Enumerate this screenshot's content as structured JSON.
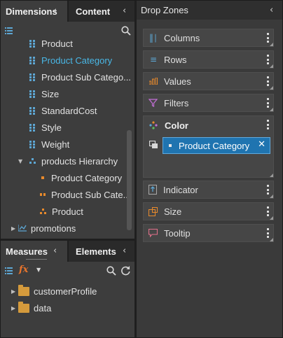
{
  "dimensions_panel": {
    "tab_dimensions": "Dimensions",
    "tab_content": "Content",
    "items": [
      {
        "label": "Product",
        "type": "field"
      },
      {
        "label": "Product Category",
        "type": "field",
        "selected": true
      },
      {
        "label": "Product Sub Catego...",
        "type": "field"
      },
      {
        "label": "Size",
        "type": "field"
      },
      {
        "label": "StandardCost",
        "type": "field"
      },
      {
        "label": "Style",
        "type": "field"
      },
      {
        "label": "Weight",
        "type": "field"
      },
      {
        "label": "products Hierarchy",
        "type": "hierarchy",
        "expanded": true
      },
      {
        "label": "Product Category",
        "type": "level-1"
      },
      {
        "label": "Product Sub Cate...",
        "type": "level-2"
      },
      {
        "label": "Product",
        "type": "level-3"
      },
      {
        "label": "promotions",
        "type": "table",
        "expanded": false
      }
    ]
  },
  "measures_panel": {
    "tab_measures": "Measures",
    "tab_elements": "Elements",
    "items": [
      {
        "label": "customerProfile"
      },
      {
        "label": "data"
      }
    ]
  },
  "drop_zones": {
    "title": "Drop Zones",
    "zones": {
      "columns": "Columns",
      "rows": "Rows",
      "values": "Values",
      "filters": "Filters",
      "color": "Color",
      "indicator": "Indicator",
      "size": "Size",
      "tooltip": "Tooltip"
    },
    "color_chip": "Product Category"
  },
  "icons": {
    "list": "list-icon",
    "search": "search-icon",
    "formula": "fx-icon",
    "refresh": "refresh-icon",
    "collapse": "chevron-left-icon",
    "kebab": "kebab-menu-icon",
    "close": "close-icon"
  },
  "colors": {
    "accent": "#49b7e6",
    "chip": "#1f74b0",
    "field_icon": "#5da6d3",
    "level_icon": "#e88a2c",
    "folder": "#d49a3c"
  }
}
